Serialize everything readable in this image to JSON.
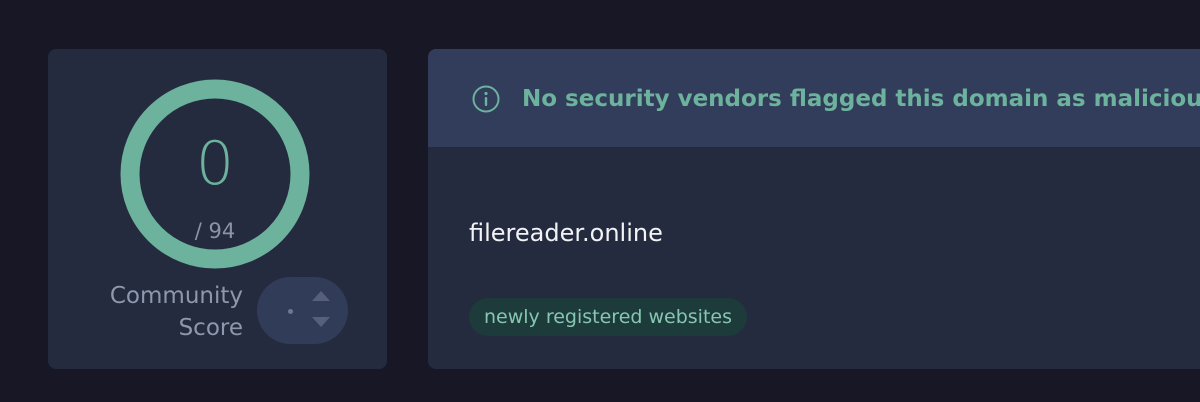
{
  "score": {
    "detections": "0",
    "total": "/ 94",
    "ring_color": "#6cb29d",
    "community_label_line1": "Community",
    "community_label_line2": "Score",
    "vote_value": "·"
  },
  "detail": {
    "banner_icon": "info-icon",
    "banner_text": "No security vendors flagged this domain as malicious",
    "domain": "filereader.online",
    "tags": [
      "newly registered websites"
    ]
  },
  "colors": {
    "background": "#171725",
    "card": "#252b3e",
    "banner": "#313d5a",
    "accent_green": "#6cb29d",
    "tag_background": "#1d3b3a"
  }
}
